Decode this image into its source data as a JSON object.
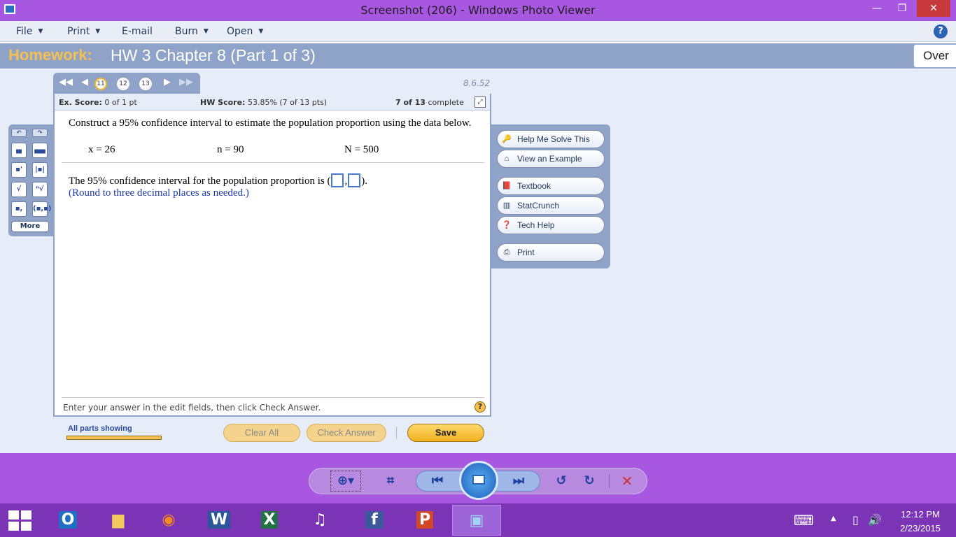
{
  "window": {
    "title": "Screenshot (206) - Windows Photo Viewer",
    "minimize": "—",
    "maximize": "❐",
    "close": "✕"
  },
  "menu": {
    "items": [
      "File",
      "Print",
      "E-mail",
      "Burn",
      "Open"
    ],
    "help": "?"
  },
  "homework": {
    "label": "Homework:",
    "title": "HW 3 Chapter 8 (Part 1 of 3)",
    "overview": "Over"
  },
  "question_nav": {
    "numbers": [
      "11",
      "12",
      "13"
    ],
    "current": "11",
    "id": "8.6.52"
  },
  "score": {
    "ex_label": "Ex. Score:",
    "ex_value": "0 of 1 pt",
    "hw_label": "HW Score:",
    "hw_value": "53.85% (7 of 13 pts)",
    "complete_bold": "7 of 13",
    "complete_rest": "complete"
  },
  "question": {
    "prompt": "Construct a 95% confidence interval to estimate the population proportion using the data below.",
    "x": "x = 26",
    "n": "n = 90",
    "N": "N = 500",
    "answer_prefix": "The 95% confidence interval for the population proportion is (",
    "answer_sep": ",",
    "answer_suffix": ").",
    "round_note": "(Round to three decimal places as needed.)",
    "footer": "Enter your answer in the edit fields, then click Check Answer.",
    "help": "?"
  },
  "tools": {
    "more": "More"
  },
  "help_panel": {
    "items": [
      "Help Me Solve This",
      "View an Example",
      "Textbook",
      "StatCrunch",
      "Tech Help",
      "Print"
    ]
  },
  "actions": {
    "parts": "All parts showing",
    "progress": 1.0,
    "clear": "Clear All",
    "check": "Check Answer",
    "save": "Save"
  },
  "taskbar": {
    "time": "12:12 PM",
    "date": "2/23/2015"
  },
  "colors": {
    "titlebar": "#a757e0",
    "homework_bar": "#8fa3c8",
    "homework_label": "#f5c052",
    "taskbar": "#7a34b5"
  }
}
